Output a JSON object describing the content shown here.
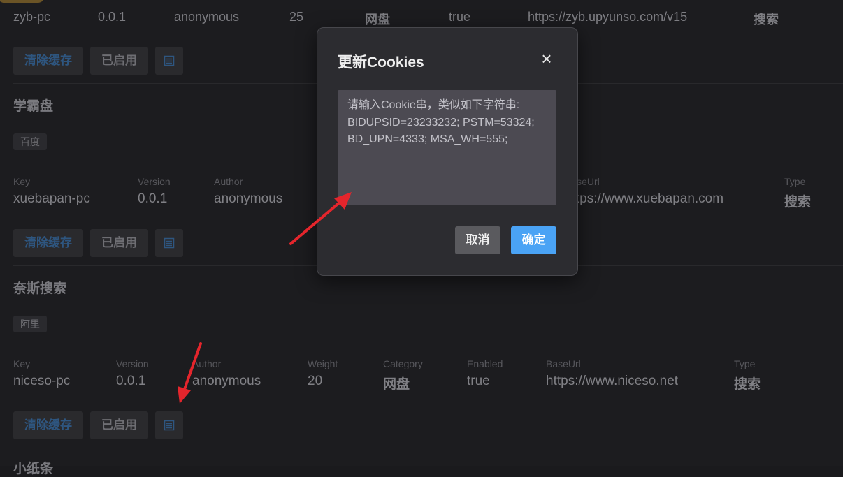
{
  "row1": {
    "key": "zyb-pc",
    "version": "0.0.1",
    "author": "anonymous",
    "weight": "25",
    "category": "网盘",
    "enabled": "true",
    "baseurl": "https://zyb.upyunso.com/v15",
    "type": "搜索"
  },
  "buttons": {
    "clear_cache": "清除缓存",
    "enabled": "已启用",
    "list_icon": "☰"
  },
  "plugin2": {
    "title": "学霸盘",
    "tag": "百度",
    "labels": {
      "key": "Key",
      "version": "Version",
      "author": "Author",
      "baseurl": "BaseUrl",
      "type": "Type"
    },
    "key": "xuebapan-pc",
    "version": "0.0.1",
    "author": "anonymous",
    "baseurl": "https://www.xuebapan.com",
    "type": "搜索"
  },
  "plugin3": {
    "title": "奈斯搜索",
    "tag": "阿里",
    "labels": {
      "key": "Key",
      "version": "Version",
      "author": "Author",
      "weight": "Weight",
      "category": "Category",
      "enabled": "Enabled",
      "baseurl": "BaseUrl",
      "type": "Type"
    },
    "key": "niceso-pc",
    "version": "0.0.1",
    "author": "anonymous",
    "weight": "20",
    "category": "网盘",
    "enabled": "true",
    "baseurl": "https://www.niceso.net",
    "type": "搜索"
  },
  "plugin4": {
    "title": "小纸条"
  },
  "modal": {
    "title": "更新Cookies",
    "close_icon": "×",
    "placeholder": "请输入Cookie串，类似如下字符串:\nBIDUPSID=23233232; PSTM=53324;\nBD_UPN=4333; MSA_WH=555;",
    "cancel": "取消",
    "confirm": "确定"
  },
  "colors": {
    "accent": "#4aa3f5",
    "arrow": "#e4252c"
  }
}
